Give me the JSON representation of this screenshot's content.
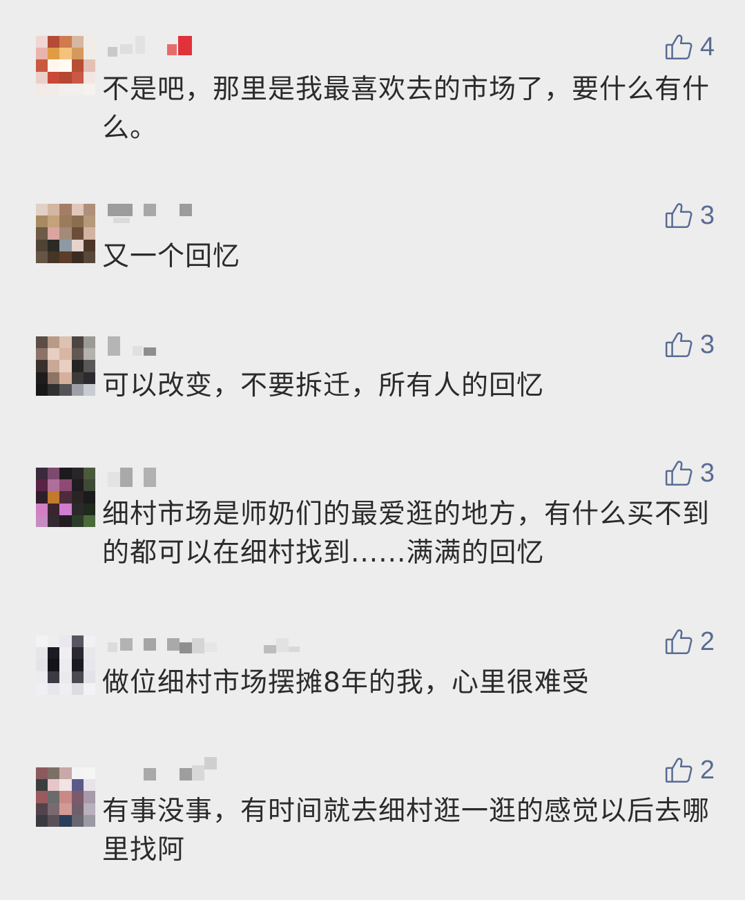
{
  "comments": [
    {
      "likes": "4",
      "text": "不是吧，那里是我最喜欢去的市场了，要什么有什么。",
      "avatar_colors": [
        "#f1d7d3",
        "#b44b36",
        "#cf7b4e",
        "#d7b79f",
        "#f1ece8",
        "#e9b4ab",
        "#df9c45",
        "#f4c27a",
        "#d49a5d",
        "#f2ece7",
        "#c95a3f",
        "#fff7ee",
        "#fffaf2",
        "#b84e36",
        "#e3c1b6",
        "#ebcfc9",
        "#c94837",
        "#b64732",
        "#c95845",
        "#f2e6e3",
        "#f3e9e6",
        "#f2ece9",
        "#f3efec",
        "#f3efed",
        "#f5f2f0"
      ]
    },
    {
      "likes": "3",
      "text": "又一个回忆",
      "avatar_colors": [
        "#e2d0c5",
        "#d4b6a4",
        "#a57d67",
        "#e0c7ba",
        "#b08f7a",
        "#a78a62",
        "#c4a27a",
        "#9a7b5b",
        "#8b6e4f",
        "#b59a7a",
        "#6f5a45",
        "#d9a5a0",
        "#a38a7b",
        "#6b4d39",
        "#d1b3a3",
        "#4e4334",
        "#2b2a24",
        "#8e9aa3",
        "#e7d3cd",
        "#4b3627",
        "#665544",
        "#463525",
        "#5c3d2a",
        "#3b2c22",
        "#58473a"
      ]
    },
    {
      "likes": "3",
      "text": "可以改变，不要拆迁，所有人的回忆",
      "avatar_colors": [
        "#5c4d45",
        "#b99a87",
        "#ddc1b2",
        "#4b4640",
        "#9c9a95",
        "#8b7467",
        "#e6cfc2",
        "#d9b5a3",
        "#625852",
        "#b4b2ae",
        "#3a302c",
        "#c8a996",
        "#e9cfc1",
        "#262524",
        "#5a5856",
        "#1e1c1c",
        "#8d7566",
        "#d7b09c",
        "#3d3b3a",
        "#2b2a2e",
        "#181818",
        "#30302f",
        "#555356",
        "#9ea0a8",
        "#c9cbd3"
      ]
    },
    {
      "likes": "3",
      "text": "细村市场是师奶们的最爱逛的地方，有什么买不到的都可以在细村找到......满满的回忆",
      "avatar_colors": [
        "#3a2a3c",
        "#7d4a6f",
        "#1c1a1c",
        "#292528",
        "#4a5a3d",
        "#5a2346",
        "#ae6f9a",
        "#8e4a73",
        "#1f1d20",
        "#3e4a36",
        "#2e1e2a",
        "#c27a2c",
        "#4c2c3c",
        "#2a2424",
        "#1c1a1a",
        "#d27fc4",
        "#3b2430",
        "#d07ccf",
        "#2a2a2a",
        "#1f2a1c",
        "#c78ac1",
        "#332a33",
        "#211d21",
        "#2c3c2a",
        "#4b6a3c"
      ]
    },
    {
      "likes": "2",
      "text": "做位细村市场摆摊8年的我，心里很难受",
      "avatar_colors": [
        "#f3f3f5",
        "#eeeef1",
        "#e8e8ee",
        "#5a5560",
        "#f1f1f3",
        "#e5e5ea",
        "#1c1a22",
        "#efeff2",
        "#2a2830",
        "#e8e8ec",
        "#e3e3e8",
        "#15131a",
        "#ececf0",
        "#1b1a20",
        "#e6e6eb",
        "#ebebf0",
        "#3c3a44",
        "#eaeaee",
        "#4a4850",
        "#e2e2e8",
        "#f0f0f4",
        "#e6e6ec",
        "#efeff3",
        "#dcdce3",
        "#f3f3f6"
      ]
    },
    {
      "likes": "2",
      "text": "有事没事，有时间就去细村逛一逛的感觉以后去哪里找阿",
      "avatar_colors": [
        "#8b5a5e",
        "#7d6f66",
        "#c9a8a8",
        "#f3f3f3",
        "#f5f5f5",
        "#3a3f3e",
        "#e6c6c8",
        "#f0e4e4",
        "#5b5a8a",
        "#e8e3ea",
        "#9a5a5e",
        "#6b6b6b",
        "#c88a86",
        "#7c5a6a",
        "#a89aaa",
        "#51444c",
        "#7a6a70",
        "#d29a94",
        "#6f5f6a",
        "#b8b0bc",
        "#3b3a40",
        "#5a5058",
        "#2a3d5a",
        "#686670",
        "#9a9aa2"
      ]
    }
  ]
}
